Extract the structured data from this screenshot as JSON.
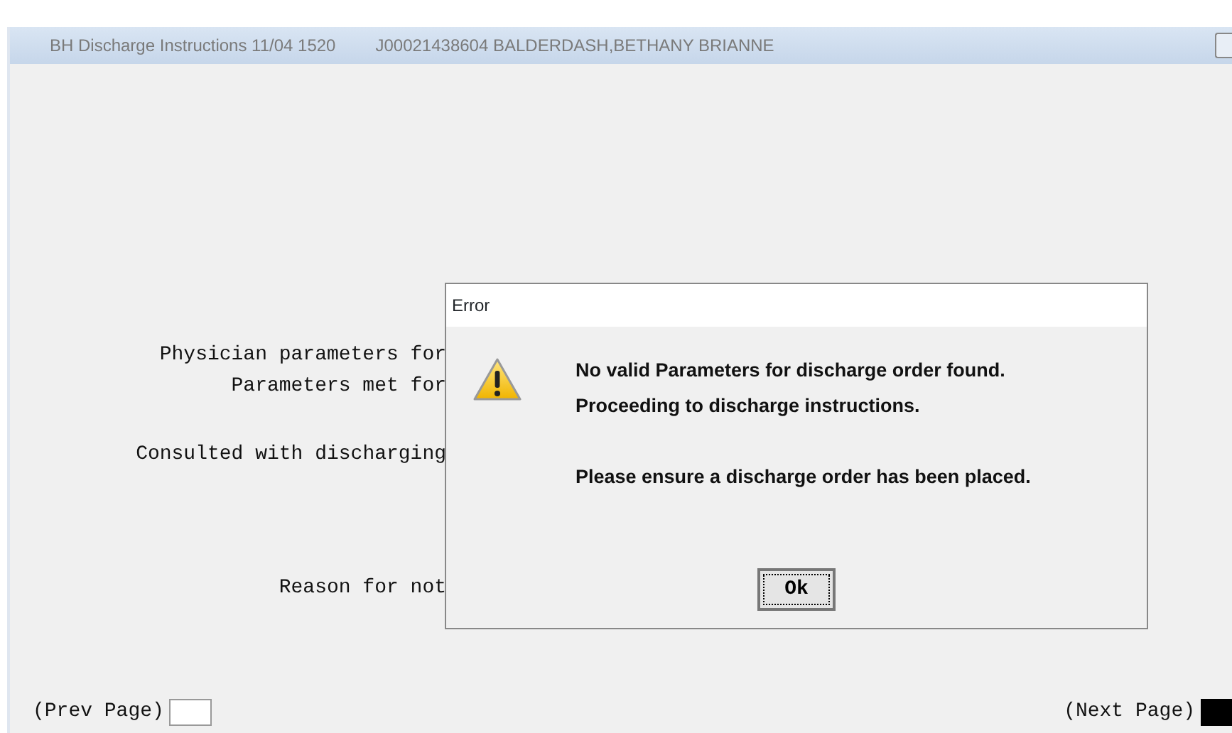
{
  "window": {
    "title": "BH Discharge Instructions  11/04 1520",
    "patient": "J00021438604  BALDERDASH,BETHANY BRIANNE"
  },
  "form_labels": [
    {
      "text": "Physician parameters for"
    },
    {
      "text": "Parameters met for"
    },
    {
      "text": "Consulted with discharging"
    },
    {
      "text": "Reason for not"
    }
  ],
  "footer": {
    "prev": {
      "label": "(Prev Page)",
      "focused": false
    },
    "next": {
      "label": "(Next Page)",
      "focused": true
    }
  },
  "dialog": {
    "title": "Error",
    "paragraphs": [
      [
        "No valid Parameters for discharge order found.",
        "Proceeding to discharge instructions."
      ],
      [
        "Please ensure a discharge order has been placed."
      ]
    ],
    "button": "Ok"
  }
}
